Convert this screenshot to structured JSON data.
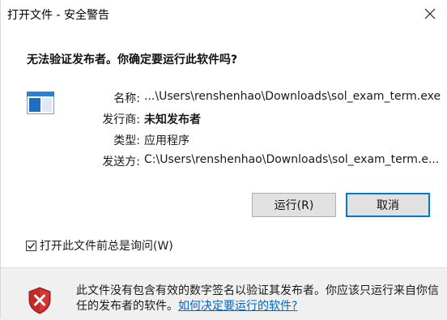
{
  "window": {
    "title": "打开文件 - 安全警告",
    "close_icon": "close-icon"
  },
  "heading": "无法验证发布者。你确定要运行此软件吗?",
  "info": {
    "name_label": "名称:",
    "name_value": "...\\Users\\renshenhao\\Downloads\\sol_exam_term.exe",
    "publisher_label": "发行商:",
    "publisher_value": "未知发布者",
    "type_label": "类型:",
    "type_value": "应用程序",
    "from_label": "发送方:",
    "from_value": "C:\\Users\\renshenhao\\Downloads\\sol_exam_term.e..."
  },
  "buttons": {
    "run": "运行(R)",
    "cancel": "取消"
  },
  "checkbox": {
    "label": "打开此文件前总是询问(W)",
    "checked": true
  },
  "footer": {
    "warning_text": "此文件没有包含有效的数字签名以验证其发布者。你应该只运行来自你信任的发布者的软件。",
    "link_text": "如何决定要运行的软件?"
  },
  "colors": {
    "accent": "#0078d7",
    "link": "#0066cc",
    "shield_red": "#c62828"
  },
  "icons": {
    "file": "application-file-icon",
    "warning": "red-shield-x-icon",
    "check": "check-icon"
  }
}
